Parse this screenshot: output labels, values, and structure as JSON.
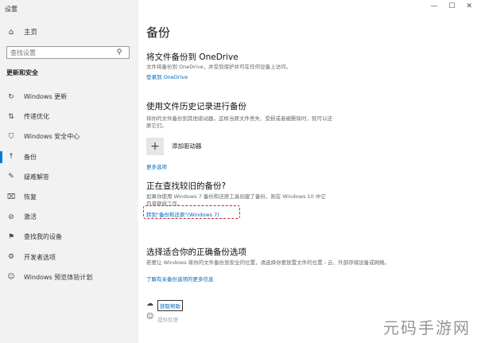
{
  "window": {
    "title": "设置",
    "controls": [
      "—",
      "☐",
      "✕"
    ]
  },
  "sidebar": {
    "home_label": "主页",
    "search_placeholder": "查找设置",
    "section_title": "更新和安全",
    "items": [
      {
        "label": "Windows 更新",
        "icon": "refresh-icon"
      },
      {
        "label": "传递优化",
        "icon": "delivery-icon"
      },
      {
        "label": "Windows 安全中心",
        "icon": "shield-icon"
      },
      {
        "label": "备份",
        "icon": "backup-arrow-icon",
        "active": true
      },
      {
        "label": "疑难解答",
        "icon": "wrench-icon"
      },
      {
        "label": "恢复",
        "icon": "recovery-icon"
      },
      {
        "label": "激活",
        "icon": "check-circle-icon"
      },
      {
        "label": "查找我的设备",
        "icon": "locate-icon"
      },
      {
        "label": "开发者选项",
        "icon": "developer-icon"
      },
      {
        "label": "Windows 预览体验计划",
        "icon": "insider-icon"
      }
    ]
  },
  "main": {
    "page_title": "备份",
    "onedrive": {
      "heading": "将文件备份到 OneDrive",
      "desc": "文件将备份到 OneDrive，并受到保护并可在任何设备上访问。",
      "link": "登录到 OneDrive"
    },
    "file_history": {
      "heading": "使用文件历史记录进行备份",
      "desc": "将你的文件备份到其他驱动器，这样当原文件丢失、受损或者被删除时，就可以还原它们。",
      "add_label": "添加驱动器",
      "more_link": "更多选项"
    },
    "older": {
      "heading": "正在查找较旧的备份?",
      "desc": "如果你使用 Windows 7 备份和还原工具创建了备份，则在 Windows 10 中它仍将继续工作。",
      "link": "转到\"备份和还原\"(Windows 7)"
    },
    "choose": {
      "heading": "选择适合你的正确备份选项",
      "desc": "若要让 Windows 将你的文件备份到安全的位置，请选择你要放置文件的位置 - 云、外部存储设备或网络。",
      "link": "了解有关备份选项的更多信息"
    },
    "help": {
      "get_help": "获取帮助",
      "feedback": "提供反馈"
    }
  },
  "watermark": "元码手游网"
}
